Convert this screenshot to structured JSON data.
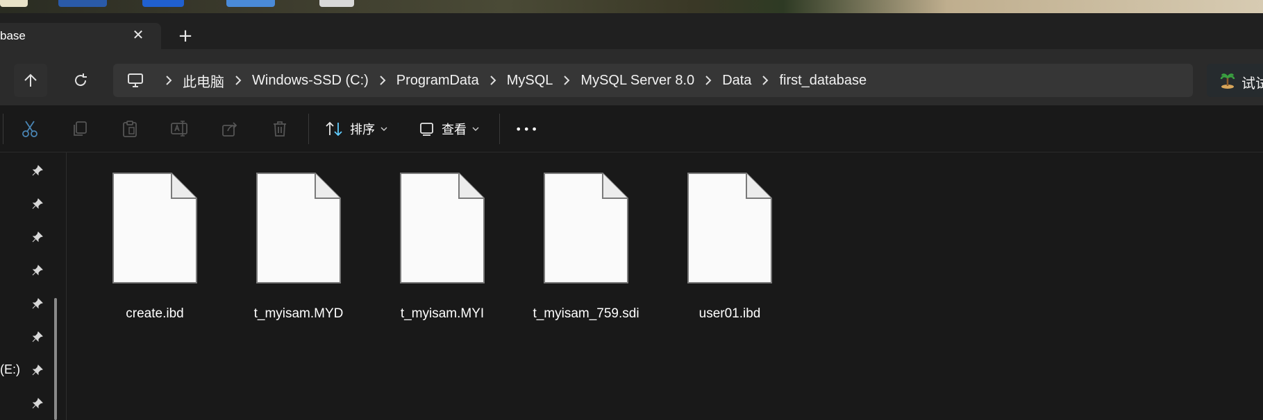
{
  "window": {
    "tab_title": "base",
    "close_glyph": "✕",
    "new_tab_glyph": "+"
  },
  "address_bar": {
    "breadcrumbs": [
      "此电脑",
      "Windows-SSD (C:)",
      "ProgramData",
      "MySQL",
      "MySQL Server 8.0",
      "Data",
      "first_database"
    ],
    "search_partial_text": "试试"
  },
  "toolbar": {
    "icons": [
      "cut-icon",
      "copy-icon",
      "paste-icon",
      "rename-icon",
      "share-icon",
      "delete-icon"
    ],
    "sort_label": "排序",
    "view_label": "查看",
    "more_glyph": "•••"
  },
  "sidebar": {
    "drive_label": "(E:)",
    "pinned_count_shown": 8
  },
  "files": [
    {
      "name": "create.ibd"
    },
    {
      "name": "t_myisam.MYD"
    },
    {
      "name": "t_myisam.MYI"
    },
    {
      "name": "t_myisam_759.sdi"
    },
    {
      "name": "user01.ibd"
    }
  ],
  "colors": {
    "background": "#191919",
    "address_bar": "#363636",
    "accent_blue": "#60cdff"
  }
}
